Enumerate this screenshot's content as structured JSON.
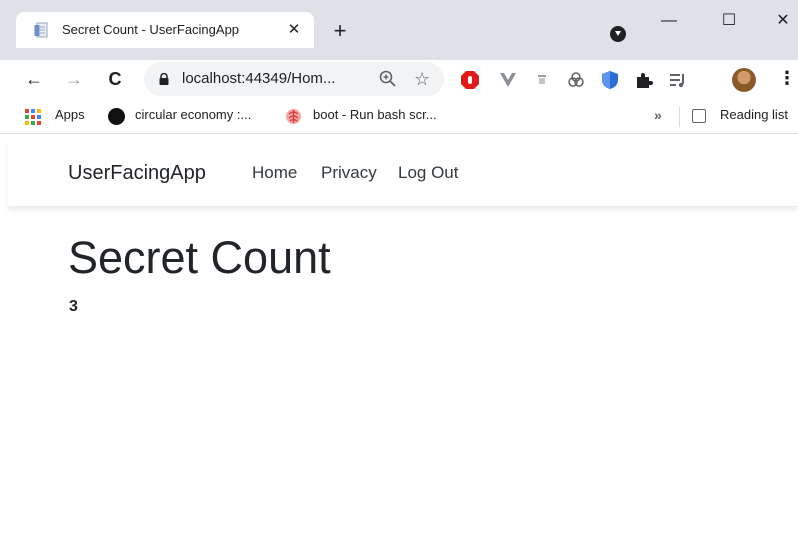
{
  "browser": {
    "tab": {
      "title": "Secret Count - UserFacingApp",
      "close_label": "✕"
    },
    "new_tab_label": "+",
    "window_controls": {
      "minimize": "—",
      "maximize": "☐",
      "close": "✕"
    },
    "toolbar": {
      "back_icon": "←",
      "forward_icon": "→",
      "reload_icon": "C",
      "url": "localhost:44349/Hom...",
      "star_icon": "☆",
      "menu_icon": "⋮"
    },
    "bookmarks": {
      "apps_label": "Apps",
      "items": [
        "circular economy :...",
        "boot - Run bash scr..."
      ],
      "overflow_label": "»",
      "reading_list_label": "Reading list"
    }
  },
  "page": {
    "navbar": {
      "brand": "UserFacingApp",
      "links": [
        "Home",
        "Privacy",
        "Log Out"
      ]
    },
    "title": "Secret Count",
    "count": "3"
  },
  "colors": {
    "chrome_frame": "#dee1e6",
    "omnibox": "#f1f3f4",
    "text": "#212529",
    "adblock_red": "#e01919"
  }
}
